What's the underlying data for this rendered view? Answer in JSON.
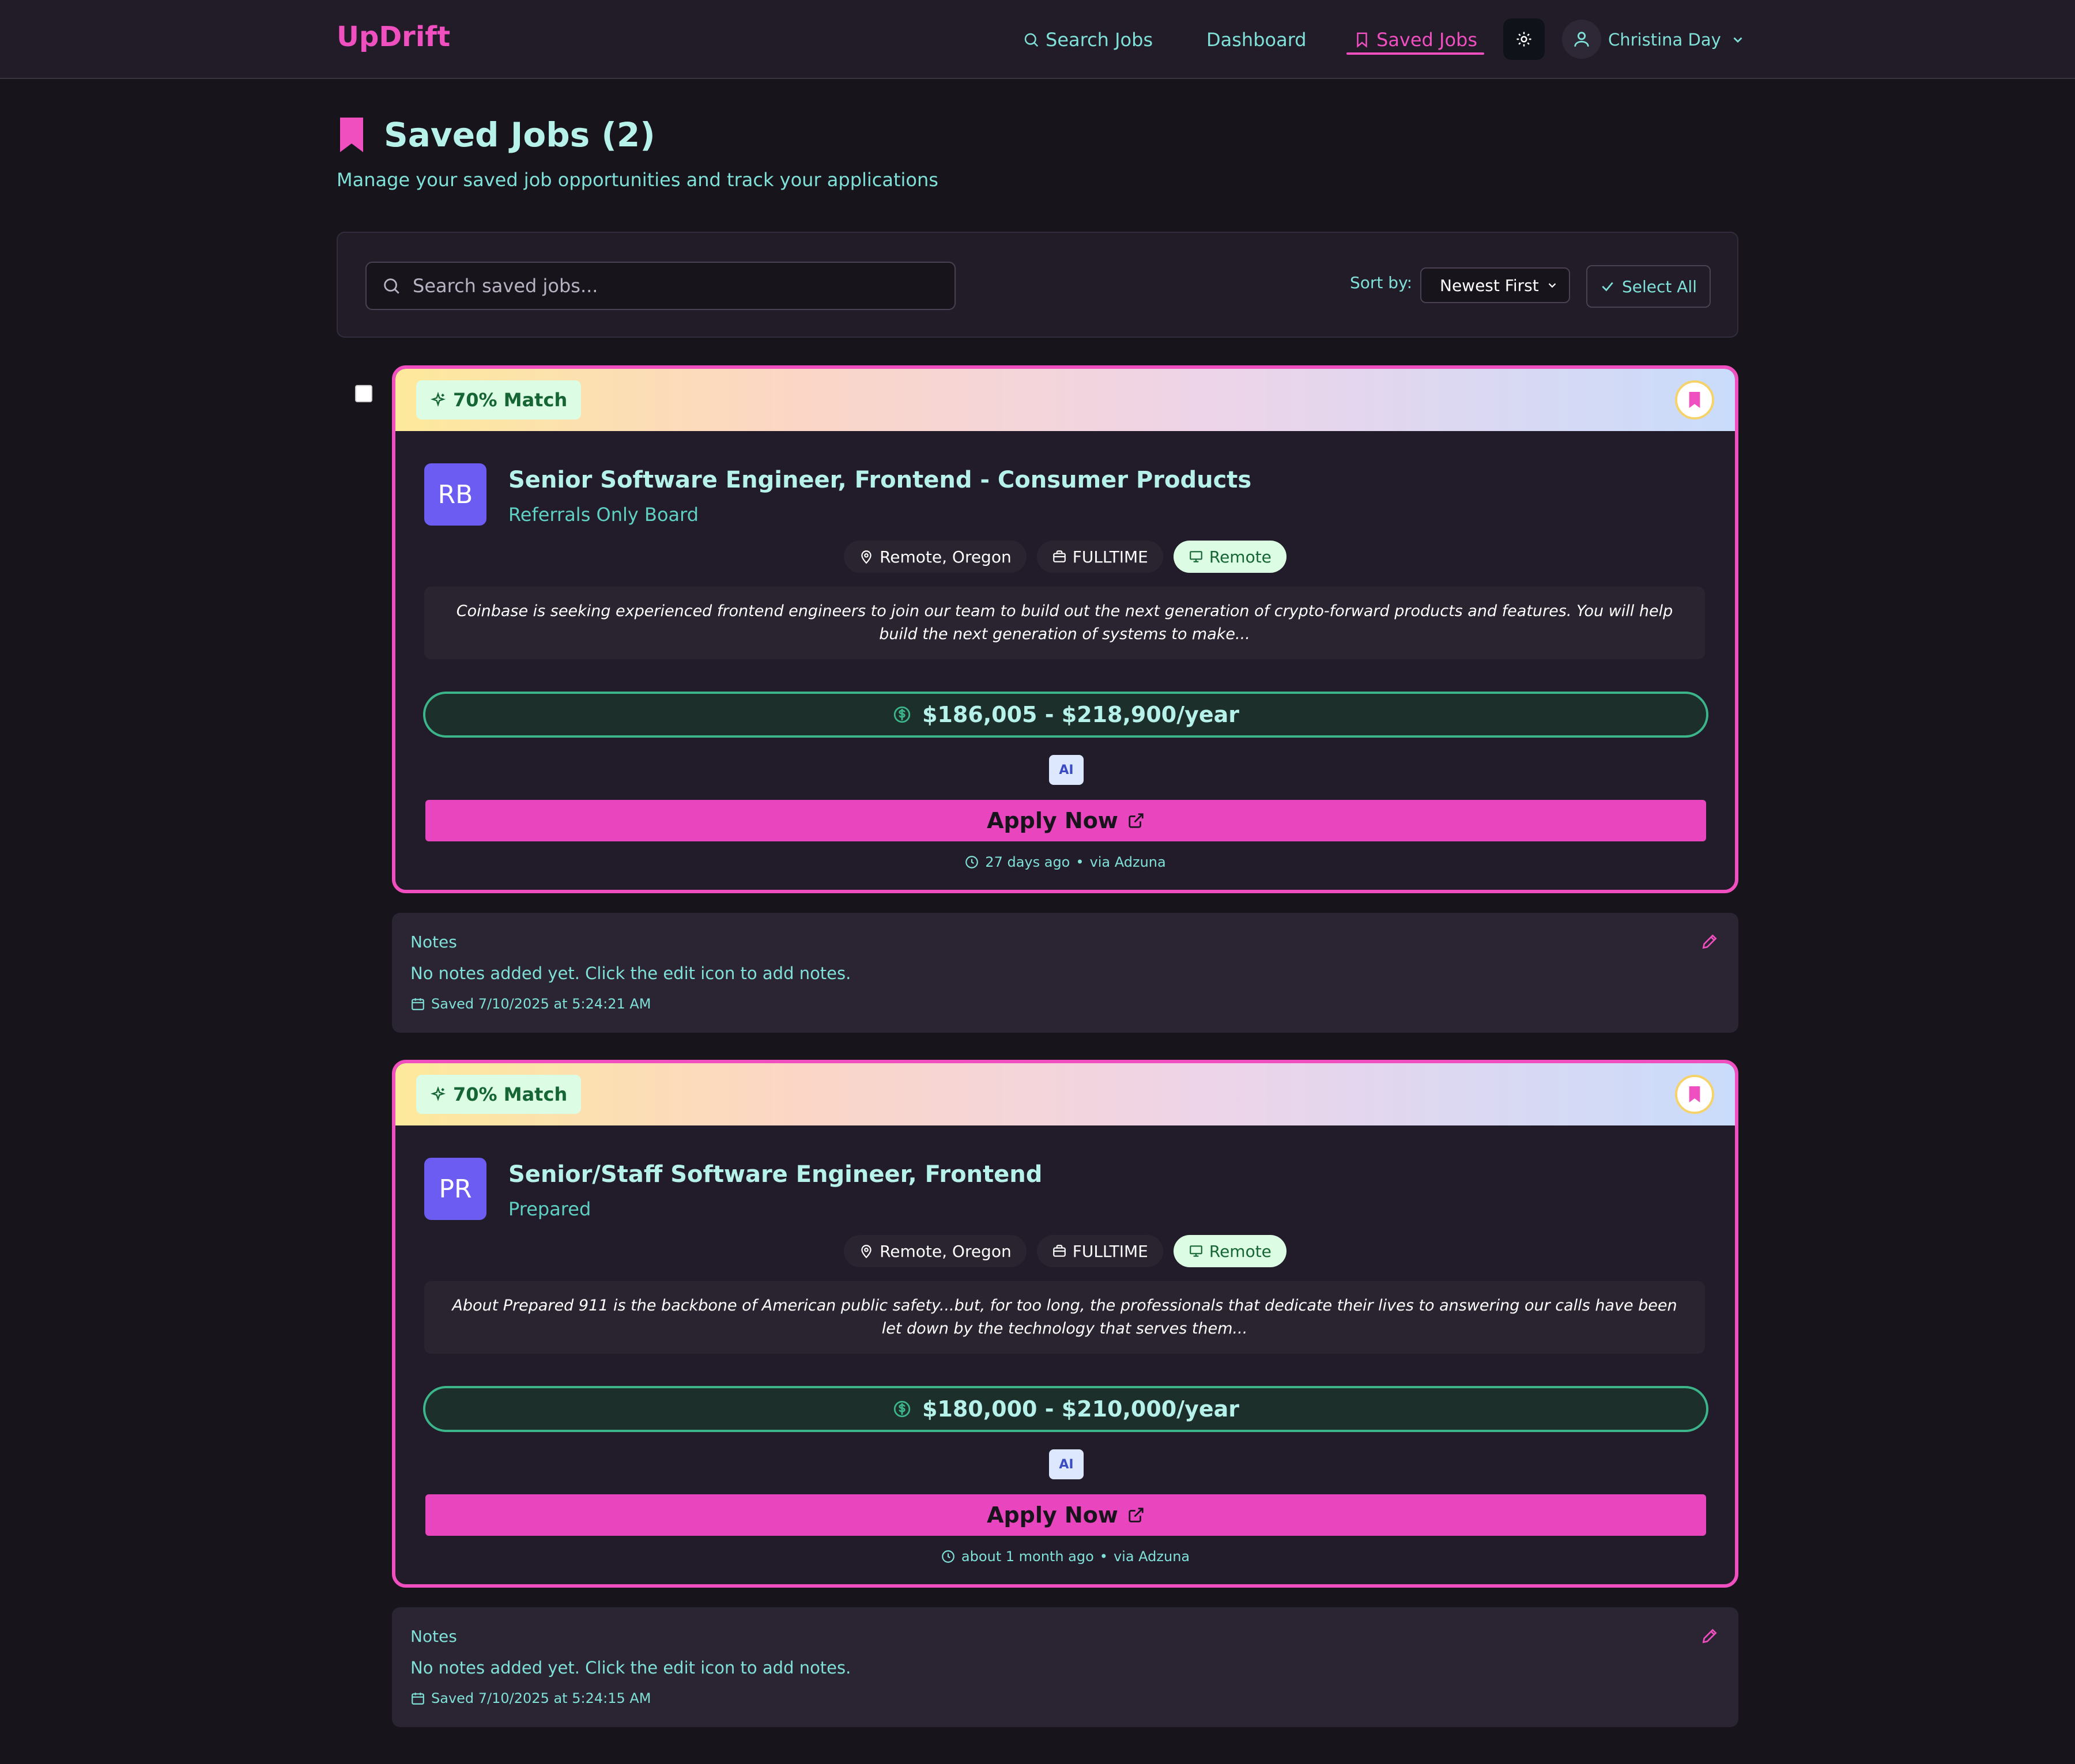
{
  "brand": {
    "logo": "UpDrift"
  },
  "nav": {
    "search_jobs": "Search Jobs",
    "dashboard": "Dashboard",
    "saved_jobs": "Saved Jobs",
    "user_name": "Christina Day"
  },
  "page": {
    "title": "Saved Jobs (2)",
    "subtitle": "Manage your saved job opportunities and track your applications"
  },
  "toolbar": {
    "search_placeholder": "Search saved jobs...",
    "sort_label": "Sort by:",
    "sort_value": "Newest First",
    "select_all": "Select All"
  },
  "jobs": [
    {
      "match": "70% Match",
      "initials": "RB",
      "title": "Senior Software Engineer, Frontend - Consumer Products",
      "company": "Referrals Only Board",
      "location": "Remote, Oregon",
      "job_type": "FULLTIME",
      "work_mode": "Remote",
      "description": "Coinbase is seeking experienced frontend engineers to join our team to build out the next generation of crypto-forward products and features. You will help build the next generation of systems to make...",
      "salary": "$186,005 - $218,900/year",
      "ai_badge": "AI",
      "apply_label": "Apply Now",
      "posted": "27 days ago",
      "source": "via Adzuna",
      "notes_label": "Notes",
      "notes_text": "No notes added yet. Click the edit icon to add notes.",
      "saved_at": "Saved 7/10/2025 at 5:24:21 AM"
    },
    {
      "match": "70% Match",
      "initials": "PR",
      "title": "Senior/Staff Software Engineer, Frontend",
      "company": "Prepared",
      "location": "Remote, Oregon",
      "job_type": "FULLTIME",
      "work_mode": "Remote",
      "description": "About Prepared 911 is the backbone of American public safety...but, for too long, the professionals that dedicate their lives to answering our calls have been let down by the technology that serves them...",
      "salary": "$180,000 - $210,000/year",
      "ai_badge": "AI",
      "apply_label": "Apply Now",
      "posted": "about 1 month ago",
      "source": "via Adzuna",
      "notes_label": "Notes",
      "notes_text": "No notes added yet. Click the edit icon to add notes.",
      "saved_at": "Saved 7/10/2025 at 5:24:15 AM"
    }
  ],
  "colors": {
    "accent": "#f04fc0",
    "teal": "#7fe1d8",
    "background": "#17141b",
    "card": "#221c2a",
    "match_green": "#166534"
  },
  "icons": [
    "search-icon",
    "bookmark-icon",
    "sun-icon",
    "user-icon",
    "chevron-down-icon",
    "check-icon",
    "sparkles-icon",
    "map-pin-icon",
    "briefcase-icon",
    "monitor-icon",
    "dollar-icon",
    "external-link-icon",
    "clock-icon",
    "calendar-icon",
    "pencil-icon"
  ]
}
